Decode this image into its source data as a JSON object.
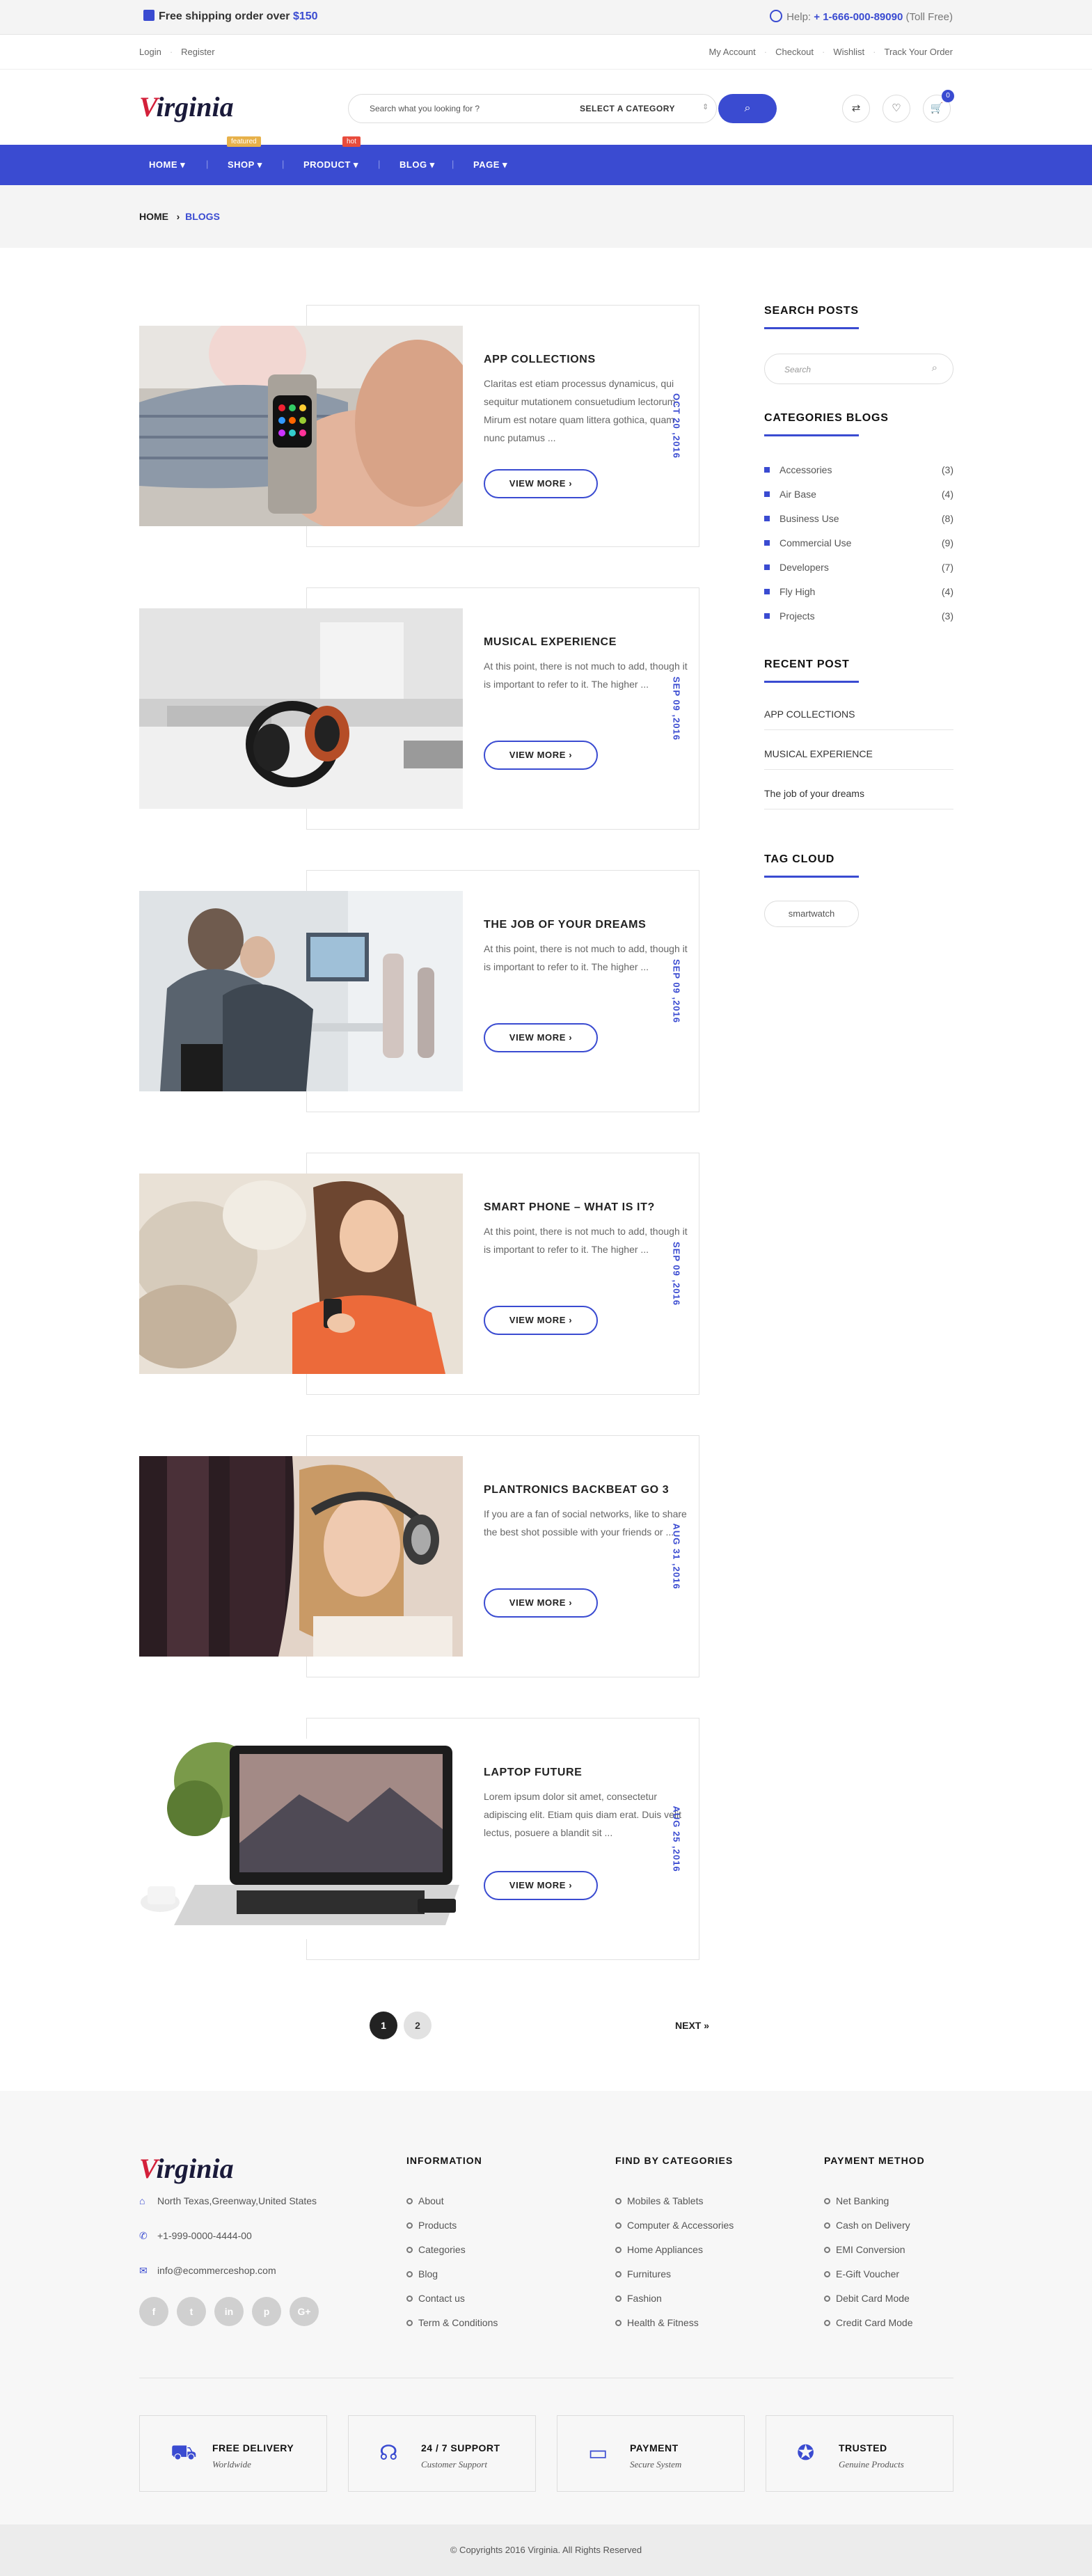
{
  "topbar": {
    "shipping_prefix": "Free shipping order over",
    "shipping_amount": "$150",
    "help_label": "Help:",
    "help_phone": "+ 1-666-000-89090",
    "help_note": "(Toll Free)"
  },
  "account_bar": {
    "login": "Login",
    "register": "Register",
    "links": [
      "My Account",
      "Checkout",
      "Wishlist",
      "Track Your Order"
    ]
  },
  "header": {
    "logo_initial": "V",
    "logo_rest": "irginia",
    "search_placeholder": "Search what you looking for ?",
    "category_select": "SELECT A CATEGORY",
    "cart_count": "0"
  },
  "nav": {
    "items": [
      "HOME ▾",
      "SHOP ▾",
      "PRODUCT ▾",
      "BLOG ▾",
      "PAGE ▾"
    ],
    "tags": {
      "shop": "featured",
      "product": "hot"
    }
  },
  "breadcrumb": {
    "home": "HOME",
    "current": "BLOGS"
  },
  "posts": [
    {
      "title": "APP COLLECTIONS",
      "excerpt": "Claritas est etiam processus dynamicus, qui sequitur mutationem consuetudium lectorum. Mirum est notare quam littera gothica, quam nunc putamus ...",
      "button": "VIEW MORE  ›",
      "date": "OCT 20 ,2016"
    },
    {
      "title": "MUSICAL EXPERIENCE",
      "excerpt": "At this point, there is not much to add, though it is important to refer to it. The higher ...",
      "button": "VIEW MORE  ›",
      "date": "SEP 09 ,2016"
    },
    {
      "title": "THE JOB OF YOUR DREAMS",
      "excerpt": "At this point, there is not much to add, though it is important to refer to it. The higher ...",
      "button": "VIEW MORE  ›",
      "date": "SEP 09 ,2016"
    },
    {
      "title": "SMART PHONE – WHAT IS IT?",
      "excerpt": "At this point, there is not much to add, though it is important to refer to it. The higher ...",
      "button": "VIEW MORE  ›",
      "date": "SEP 09 ,2016"
    },
    {
      "title": "PLANTRONICS BACKBEAT GO 3",
      "excerpt": "If you are a fan of social networks, like to share the best shot possible with your friends or ...",
      "button": "VIEW MORE  ›",
      "date": "AUG 31 ,2016"
    },
    {
      "title": "LAPTOP FUTURE",
      "excerpt": "Lorem ipsum dolor sit amet, consectetur adipiscing elit. Etiam quis diam erat. Duis velit lectus, posuere a blandit sit ...",
      "button": "VIEW MORE  ›",
      "date": "AUG 25 ,2016"
    }
  ],
  "sidebar": {
    "search_title": "SEARCH POSTS",
    "search_placeholder": "Search",
    "categories_title": "CATEGORIES BLOGS",
    "categories": [
      {
        "name": "Accessories",
        "count": "(3)"
      },
      {
        "name": "Air Base",
        "count": "(4)"
      },
      {
        "name": "Business Use",
        "count": "(8)"
      },
      {
        "name": "Commercial Use",
        "count": "(9)"
      },
      {
        "name": "Developers",
        "count": "(7)"
      },
      {
        "name": "Fly High",
        "count": "(4)"
      },
      {
        "name": "Projects",
        "count": "(3)"
      }
    ],
    "recent_title": "RECENT POST",
    "recent": [
      "APP COLLECTIONS",
      "MUSICAL EXPERIENCE",
      "The job of your dreams"
    ],
    "tag_title": "TAG CLOUD",
    "tags": [
      "smartwatch"
    ]
  },
  "pagination": {
    "pages": [
      "1",
      "2"
    ],
    "next": "NEXT »"
  },
  "footer": {
    "logo_initial": "V",
    "logo_rest": "irginia",
    "address": "North Texas,Greenway,United States",
    "phone": "+1-999-0000-4444-00",
    "email": "info@ecommerceshop.com",
    "social": [
      "f",
      "t",
      "in",
      "p",
      "G+"
    ],
    "columns": [
      {
        "title": "INFORMATION",
        "links": [
          "About",
          "Products",
          "Categories",
          "Blog",
          "Contact us",
          "Term & Conditions"
        ]
      },
      {
        "title": "FIND BY CATEGORIES",
        "links": [
          "Mobiles & Tablets",
          "Computer & Accessories",
          "Home Appliances",
          "Furnitures",
          "Fashion",
          "Health & Fitness"
        ]
      },
      {
        "title": "PAYMENT METHOD",
        "links": [
          "Net Banking",
          "Cash on Delivery",
          "EMI Conversion",
          "E-Gift Voucher",
          "Debit Card Mode",
          "Credit Card Mode"
        ]
      }
    ],
    "features": [
      {
        "title": "FREE DELIVERY",
        "sub": "Worldwide",
        "icon": "truck-icon"
      },
      {
        "title": "24 / 7 SUPPORT",
        "sub": "Customer Support",
        "icon": "headset-icon"
      },
      {
        "title": "PAYMENT",
        "sub": "Secure System",
        "icon": "card-icon"
      },
      {
        "title": "TRUSTED",
        "sub": "Genuine Products",
        "icon": "medal-icon"
      }
    ],
    "copyright": "© Copyrights 2016 Virginia. All Rights Reserved"
  },
  "colors": {
    "accent": "#3a4bd1",
    "logo_red": "#d3203a",
    "tag_featured": "#e7b14a",
    "tag_hot": "#e84c3d"
  }
}
